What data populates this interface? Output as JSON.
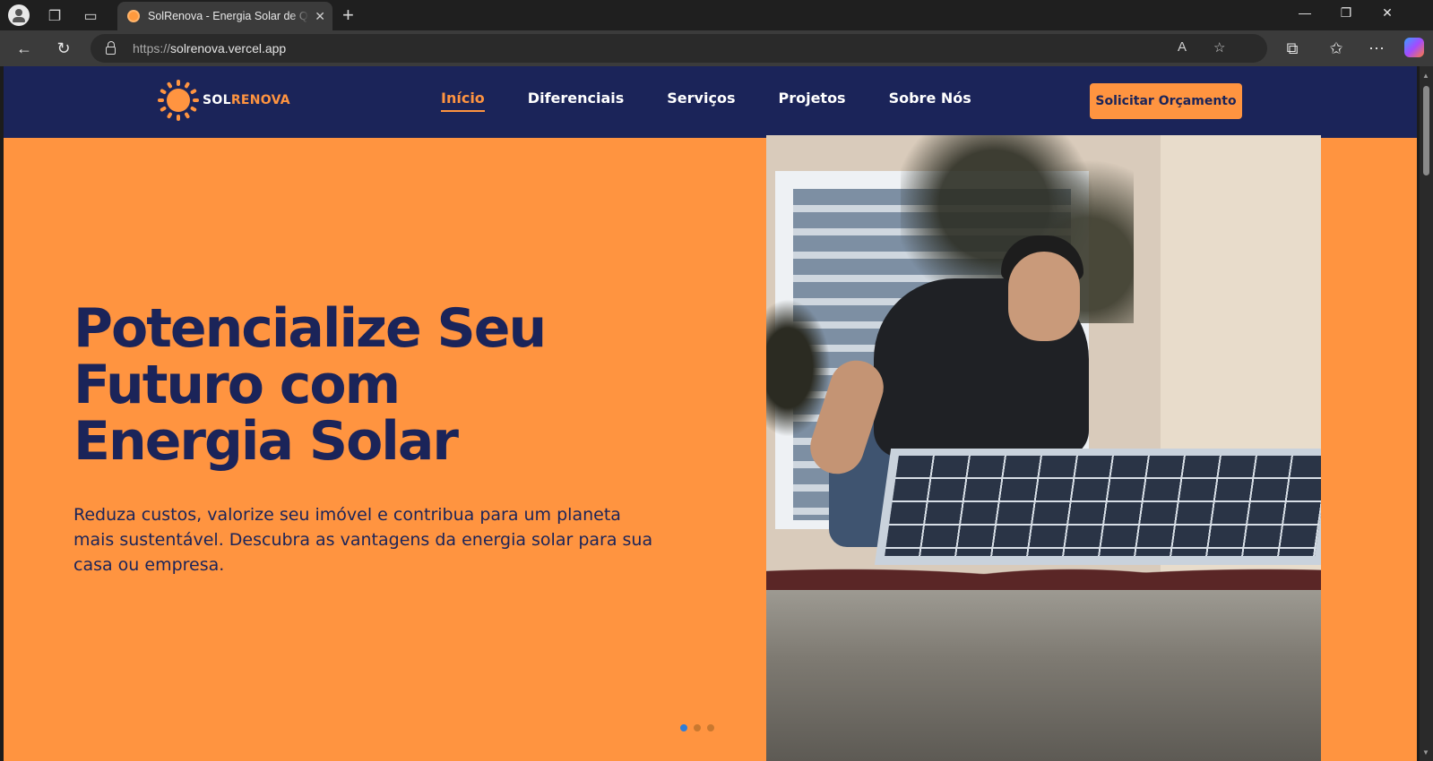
{
  "browser": {
    "tab_title": "SolRenova - Energia Solar de Qualidade",
    "tab_close": "✕",
    "new_tab": "+",
    "url_protocol": "https://",
    "url_host": "solrenova.vercel.app",
    "icons": [
      "profile-icon",
      "workspaces-icon",
      "tab-actions-icon",
      "back-icon",
      "refresh-icon",
      "lock-icon",
      "read-aloud-icon",
      "favorite-icon",
      "extensions-icon",
      "favorites-icon",
      "more-icon",
      "copilot-icon",
      "minimize-icon",
      "restore-icon",
      "close-icon"
    ]
  },
  "site": {
    "logo_white": "SOL",
    "logo_orange": "RENOVA",
    "nav": [
      {
        "label": "Início",
        "active": true
      },
      {
        "label": "Diferenciais"
      },
      {
        "label": "Serviços"
      },
      {
        "label": "Projetos"
      },
      {
        "label": "Sobre Nós"
      }
    ],
    "cta": "Solicitar Orçamento",
    "hero": {
      "title_lines": [
        "Potencialize Seu",
        "Futuro com",
        "Energia Solar"
      ],
      "subtitle": "Reduza custos, valorize seu imóvel e contribua para um planeta mais sustentável. Descubra as vantagens da energia solar para sua casa ou empresa."
    },
    "carousel": {
      "slides": 3,
      "active": 1
    },
    "colors": {
      "navy": "#1b2459",
      "orange": "#ff9440",
      "dot_active": "#2f7dd8"
    }
  }
}
